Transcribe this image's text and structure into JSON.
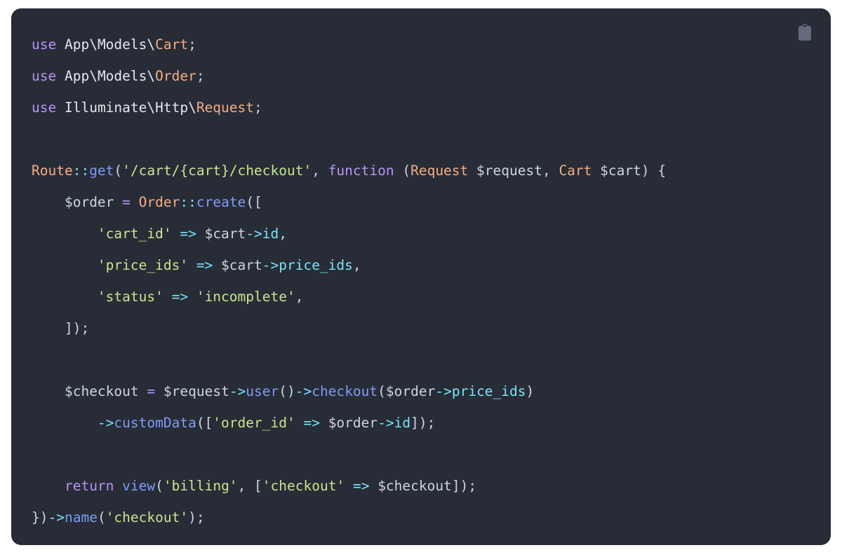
{
  "card": {
    "background_color": "#282c37",
    "page_background_color": "#ffffff",
    "corner_radius": "14px"
  },
  "copy_button": {
    "icon": "clipboard-icon",
    "label": "Copy",
    "color": "#6b7280"
  },
  "code": {
    "language": "php",
    "full_text": "use App\\Models\\Cart;\nuse App\\Models\\Order;\nuse Illuminate\\Http\\Request;\n\nRoute::get('/cart/{cart}/checkout', function (Request $request, Cart $cart) {\n    $order = Order::create([\n        'cart_id' => $cart->id,\n        'price_ids' => $cart->price_ids,\n        'status' => 'incomplete',\n    ]);\n\n    $checkout = $request->user()->checkout($order->price_ids)\n        ->customData(['order_id' => $order->id]);\n\n    return view('billing', ['checkout' => $checkout]);\n})->name('checkout');",
    "lines": [
      {
        "n": 1,
        "text": "use App\\Models\\Cart;",
        "tokens": [
          {
            "t": "use",
            "c": "keyword"
          },
          {
            "t": " ",
            "c": "plain"
          },
          {
            "t": "App\\Models\\",
            "c": "namespace"
          },
          {
            "t": "Cart",
            "c": "class"
          },
          {
            "t": ";",
            "c": "punctuation"
          }
        ]
      },
      {
        "n": 2,
        "text": "use App\\Models\\Order;",
        "tokens": [
          {
            "t": "use",
            "c": "keyword"
          },
          {
            "t": " ",
            "c": "plain"
          },
          {
            "t": "App\\Models\\",
            "c": "namespace"
          },
          {
            "t": "Order",
            "c": "class"
          },
          {
            "t": ";",
            "c": "punctuation"
          }
        ]
      },
      {
        "n": 3,
        "text": "use Illuminate\\Http\\Request;",
        "tokens": [
          {
            "t": "use",
            "c": "keyword"
          },
          {
            "t": " ",
            "c": "plain"
          },
          {
            "t": "Illuminate\\Http\\",
            "c": "namespace"
          },
          {
            "t": "Request",
            "c": "class"
          },
          {
            "t": ";",
            "c": "punctuation"
          }
        ]
      },
      {
        "n": 4,
        "text": "",
        "tokens": []
      },
      {
        "n": 5,
        "text": "Route::get('/cart/{cart}/checkout', function (Request $request, Cart $cart) {",
        "tokens": [
          {
            "t": "Route",
            "c": "class"
          },
          {
            "t": "::",
            "c": "double-colon"
          },
          {
            "t": "get",
            "c": "function"
          },
          {
            "t": "(",
            "c": "punctuation"
          },
          {
            "t": "'/cart/{cart}/checkout'",
            "c": "string"
          },
          {
            "t": ", ",
            "c": "punctuation"
          },
          {
            "t": "function",
            "c": "keyword"
          },
          {
            "t": " (",
            "c": "punctuation"
          },
          {
            "t": "Request",
            "c": "class"
          },
          {
            "t": " ",
            "c": "plain"
          },
          {
            "t": "$request",
            "c": "variable"
          },
          {
            "t": ", ",
            "c": "punctuation"
          },
          {
            "t": "Cart",
            "c": "class"
          },
          {
            "t": " ",
            "c": "plain"
          },
          {
            "t": "$cart",
            "c": "variable"
          },
          {
            "t": ") {",
            "c": "punctuation"
          }
        ]
      },
      {
        "n": 6,
        "text": "    $order = Order::create([",
        "tokens": [
          {
            "t": "    ",
            "c": "plain"
          },
          {
            "t": "$order",
            "c": "variable"
          },
          {
            "t": " ",
            "c": "plain"
          },
          {
            "t": "=",
            "c": "operator"
          },
          {
            "t": " ",
            "c": "plain"
          },
          {
            "t": "Order",
            "c": "class"
          },
          {
            "t": "::",
            "c": "double-colon"
          },
          {
            "t": "create",
            "c": "function"
          },
          {
            "t": "([",
            "c": "punctuation"
          }
        ]
      },
      {
        "n": 7,
        "text": "        'cart_id' => $cart->id,",
        "tokens": [
          {
            "t": "        ",
            "c": "plain"
          },
          {
            "t": "'cart_id'",
            "c": "string"
          },
          {
            "t": " ",
            "c": "plain"
          },
          {
            "t": "=>",
            "c": "arrow"
          },
          {
            "t": " ",
            "c": "plain"
          },
          {
            "t": "$cart",
            "c": "variable"
          },
          {
            "t": "->",
            "c": "arrow"
          },
          {
            "t": "id",
            "c": "property"
          },
          {
            "t": ",",
            "c": "punctuation"
          }
        ]
      },
      {
        "n": 8,
        "text": "        'price_ids' => $cart->price_ids,",
        "tokens": [
          {
            "t": "        ",
            "c": "plain"
          },
          {
            "t": "'price_ids'",
            "c": "string"
          },
          {
            "t": " ",
            "c": "plain"
          },
          {
            "t": "=>",
            "c": "arrow"
          },
          {
            "t": " ",
            "c": "plain"
          },
          {
            "t": "$cart",
            "c": "variable"
          },
          {
            "t": "->",
            "c": "arrow"
          },
          {
            "t": "price_ids",
            "c": "property"
          },
          {
            "t": ",",
            "c": "punctuation"
          }
        ]
      },
      {
        "n": 9,
        "text": "        'status' => 'incomplete',",
        "tokens": [
          {
            "t": "        ",
            "c": "plain"
          },
          {
            "t": "'status'",
            "c": "string"
          },
          {
            "t": " ",
            "c": "plain"
          },
          {
            "t": "=>",
            "c": "arrow"
          },
          {
            "t": " ",
            "c": "plain"
          },
          {
            "t": "'incomplete'",
            "c": "string"
          },
          {
            "t": ",",
            "c": "punctuation"
          }
        ]
      },
      {
        "n": 10,
        "text": "    ]);",
        "tokens": [
          {
            "t": "    ",
            "c": "plain"
          },
          {
            "t": "]);",
            "c": "punctuation"
          }
        ]
      },
      {
        "n": 11,
        "text": "",
        "tokens": []
      },
      {
        "n": 12,
        "text": "    $checkout = $request->user()->checkout($order->price_ids)",
        "tokens": [
          {
            "t": "    ",
            "c": "plain"
          },
          {
            "t": "$checkout",
            "c": "variable"
          },
          {
            "t": " ",
            "c": "plain"
          },
          {
            "t": "=",
            "c": "operator"
          },
          {
            "t": " ",
            "c": "plain"
          },
          {
            "t": "$request",
            "c": "variable"
          },
          {
            "t": "->",
            "c": "arrow"
          },
          {
            "t": "user",
            "c": "function"
          },
          {
            "t": "()",
            "c": "punctuation"
          },
          {
            "t": "->",
            "c": "arrow"
          },
          {
            "t": "checkout",
            "c": "function"
          },
          {
            "t": "(",
            "c": "punctuation"
          },
          {
            "t": "$order",
            "c": "variable"
          },
          {
            "t": "->",
            "c": "arrow"
          },
          {
            "t": "price_ids",
            "c": "property"
          },
          {
            "t": ")",
            "c": "punctuation"
          }
        ]
      },
      {
        "n": 13,
        "text": "        ->customData(['order_id' => $order->id]);",
        "tokens": [
          {
            "t": "        ",
            "c": "plain"
          },
          {
            "t": "->",
            "c": "arrow"
          },
          {
            "t": "customData",
            "c": "function"
          },
          {
            "t": "([",
            "c": "punctuation"
          },
          {
            "t": "'order_id'",
            "c": "string"
          },
          {
            "t": " ",
            "c": "plain"
          },
          {
            "t": "=>",
            "c": "arrow"
          },
          {
            "t": " ",
            "c": "plain"
          },
          {
            "t": "$order",
            "c": "variable"
          },
          {
            "t": "->",
            "c": "arrow"
          },
          {
            "t": "id",
            "c": "property"
          },
          {
            "t": "]);",
            "c": "punctuation"
          }
        ]
      },
      {
        "n": 14,
        "text": "",
        "tokens": []
      },
      {
        "n": 15,
        "text": "    return view('billing', ['checkout' => $checkout]);",
        "tokens": [
          {
            "t": "    ",
            "c": "plain"
          },
          {
            "t": "return",
            "c": "keyword"
          },
          {
            "t": " ",
            "c": "plain"
          },
          {
            "t": "view",
            "c": "function"
          },
          {
            "t": "(",
            "c": "punctuation"
          },
          {
            "t": "'billing'",
            "c": "string"
          },
          {
            "t": ", [",
            "c": "punctuation"
          },
          {
            "t": "'checkout'",
            "c": "string"
          },
          {
            "t": " ",
            "c": "plain"
          },
          {
            "t": "=>",
            "c": "arrow"
          },
          {
            "t": " ",
            "c": "plain"
          },
          {
            "t": "$checkout",
            "c": "variable"
          },
          {
            "t": "]);",
            "c": "punctuation"
          }
        ]
      },
      {
        "n": 16,
        "text": "})->name('checkout');",
        "tokens": [
          {
            "t": "})",
            "c": "punctuation"
          },
          {
            "t": "->",
            "c": "arrow"
          },
          {
            "t": "name",
            "c": "function"
          },
          {
            "t": "(",
            "c": "punctuation"
          },
          {
            "t": "'checkout'",
            "c": "string"
          },
          {
            "t": ");",
            "c": "punctuation"
          }
        ]
      }
    ],
    "token_colors": {
      "keyword": "#b794f4",
      "class": "#f6ad80",
      "namespace": "#e2e8f0",
      "function": "#7f9cf5",
      "string": "#c3e88d",
      "operator": "#b794f4",
      "arrow": "#76e4f7",
      "property": "#76e4f7",
      "double-colon": "#76e4f7",
      "variable": "#cbd5e0",
      "punctuation": "#cbd5e0",
      "plain": "#d6d9e0"
    }
  }
}
